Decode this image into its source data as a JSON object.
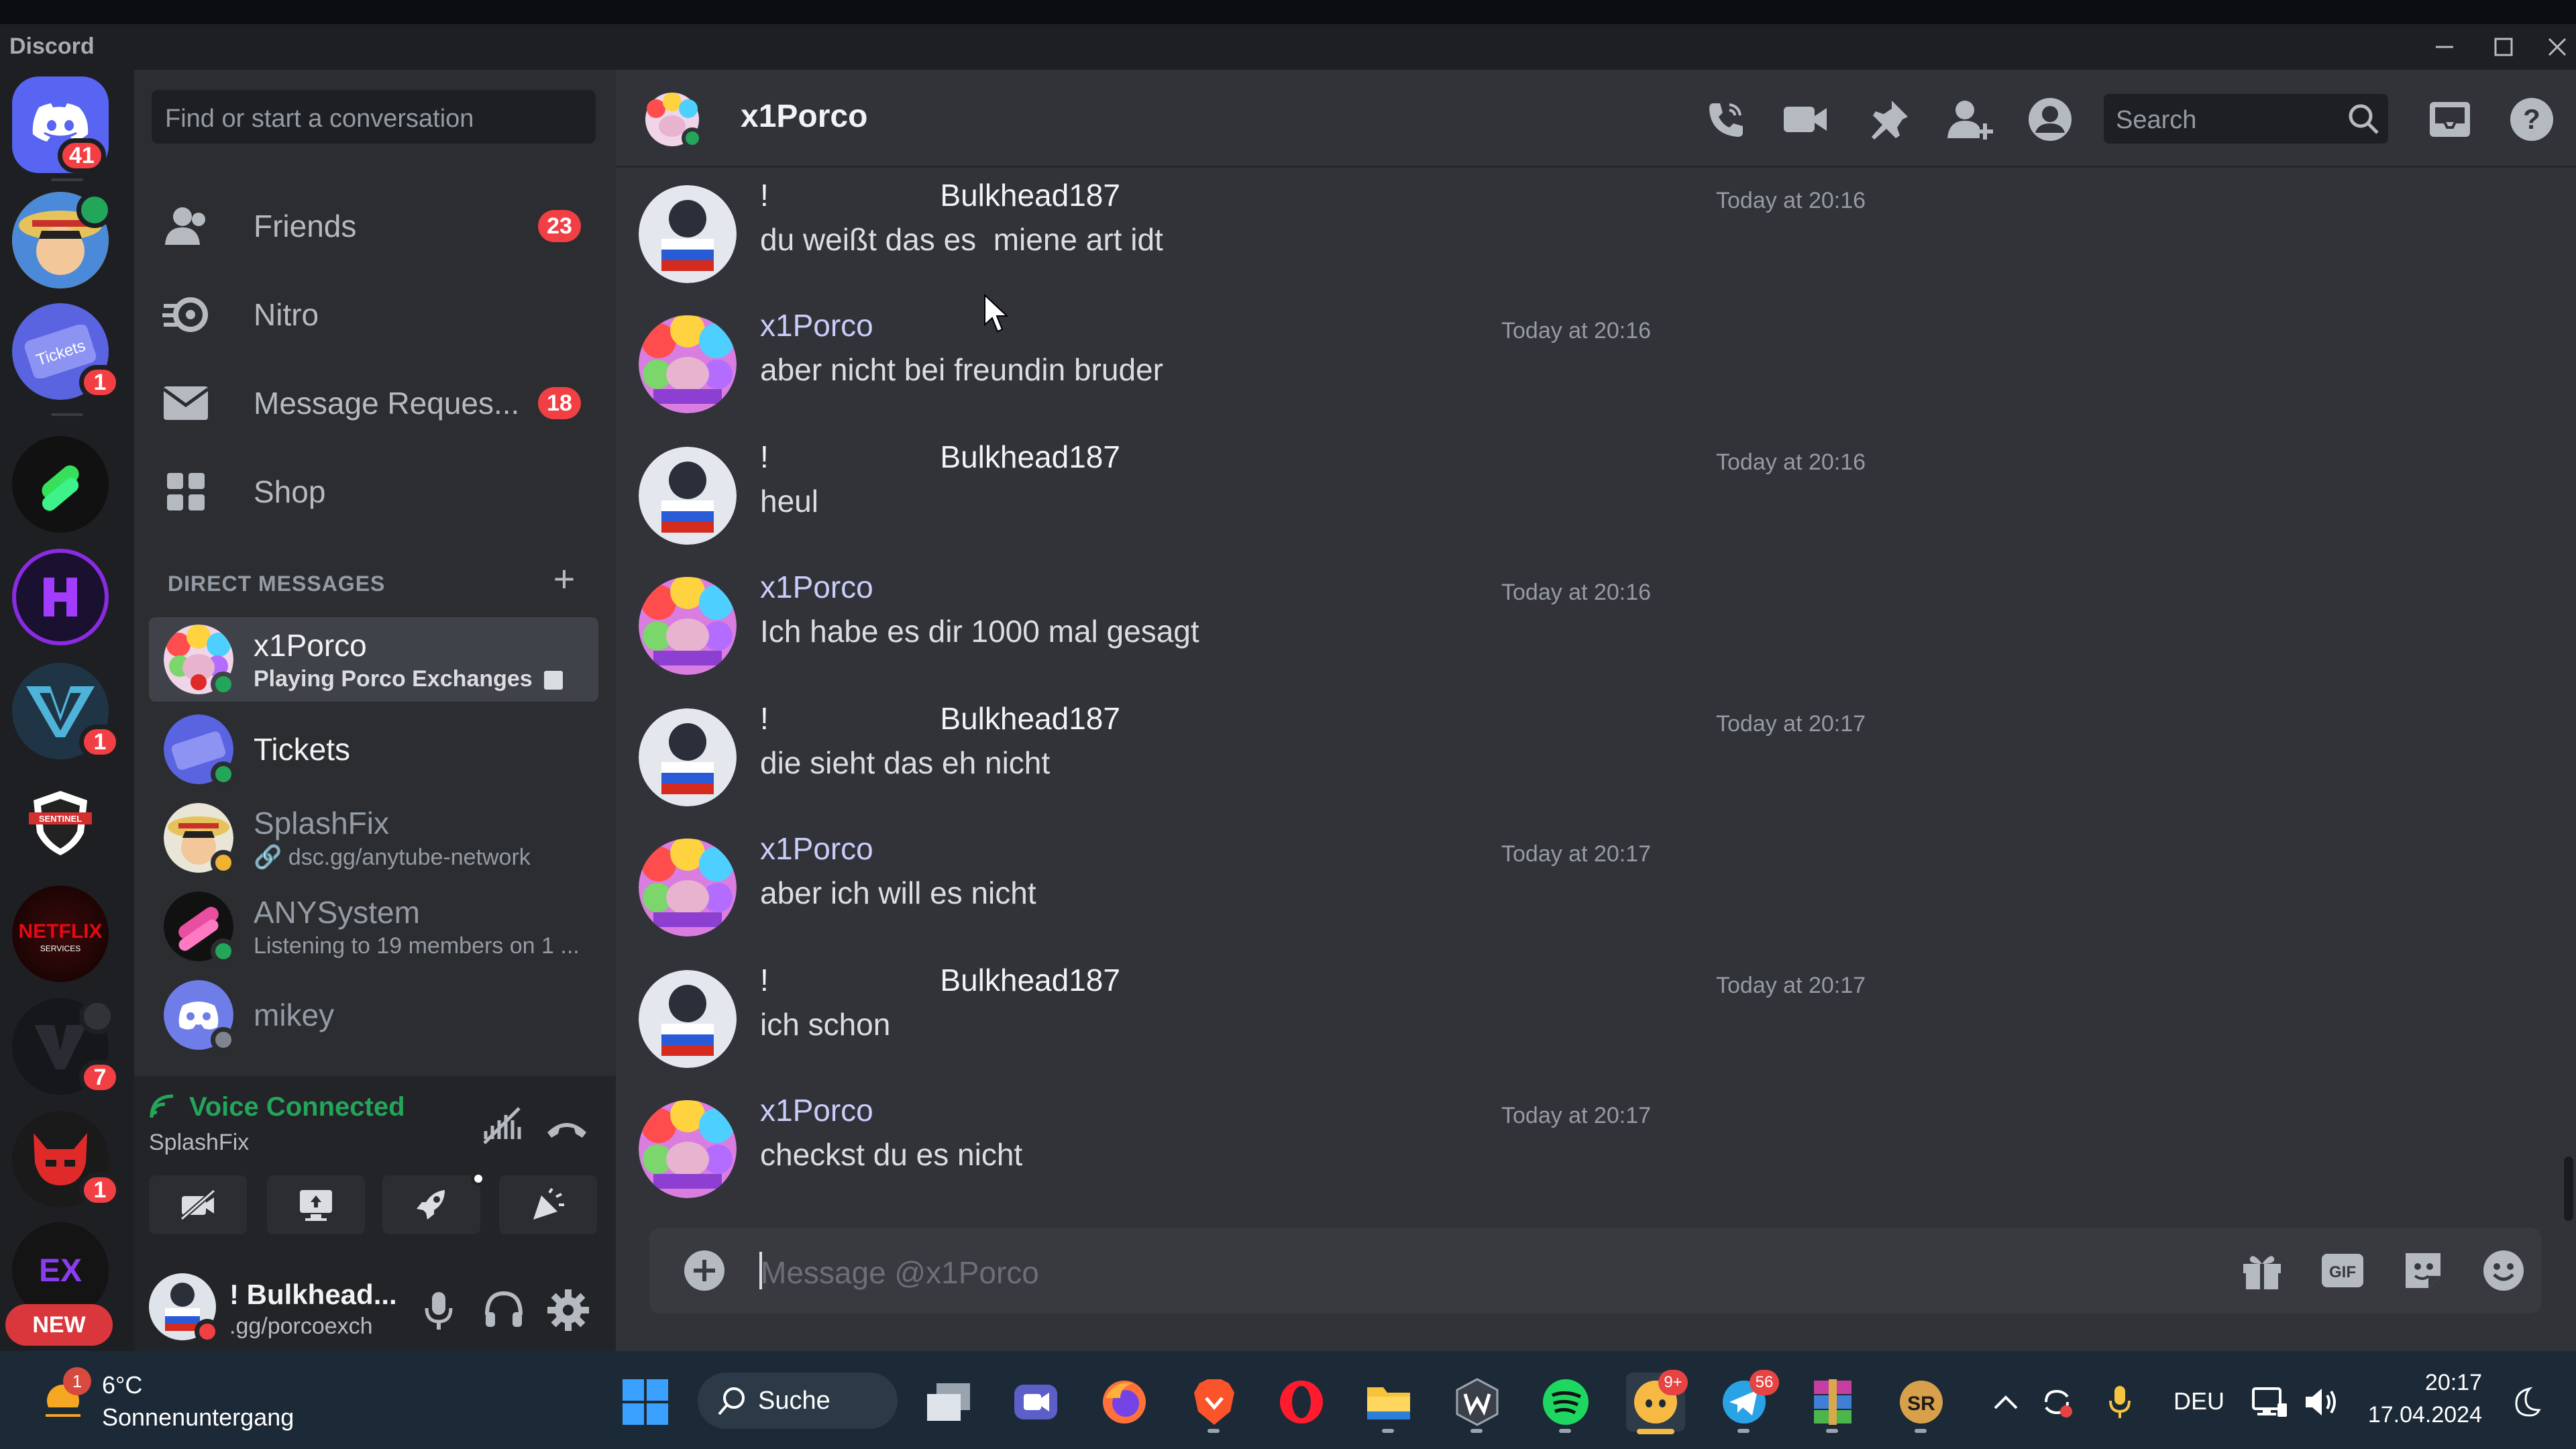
{
  "app": {
    "title": "Discord"
  },
  "servers": [
    {
      "name": "home",
      "badge": "41"
    },
    {
      "name": "SplashFix"
    },
    {
      "name": "Tickets",
      "badge": "1"
    },
    {
      "name": "ANYSystem"
    },
    {
      "name": "H"
    },
    {
      "name": "V",
      "badge": "1"
    },
    {
      "name": "Sentinel",
      "logo_text": "SENTINEL"
    },
    {
      "name": "Netflix Services",
      "logo_text": "NETFLIX",
      "logo_sub": "SERVICES"
    },
    {
      "name": "V dark",
      "badge": "7"
    },
    {
      "name": "Red",
      "badge": "1"
    },
    {
      "name": "EX",
      "logo_text": "EX"
    }
  ],
  "rail_new_label": "NEW",
  "sidebar": {
    "search_placeholder": "Find or start a conversation",
    "nav": [
      {
        "label": "Friends",
        "badge": "23"
      },
      {
        "label": "Nitro"
      },
      {
        "label": "Message Reques...",
        "badge": "18"
      },
      {
        "label": "Shop"
      }
    ],
    "dm_header": "DIRECT MESSAGES",
    "dms": [
      {
        "name": "x1Porco",
        "sub": "Playing Porco Exchanges"
      },
      {
        "name": "Tickets",
        "sub": ""
      },
      {
        "name": "SplashFix",
        "sub": "dsc.gg/anytube-network"
      },
      {
        "name": "ANYSystem",
        "sub": "Listening to 19 members on 1 ..."
      },
      {
        "name": "mikey",
        "sub": ""
      }
    ]
  },
  "voice": {
    "status": "Voice Connected",
    "channel": "SplashFix"
  },
  "user": {
    "name": "! Bulkhead...",
    "sub": ".gg/porcoexch"
  },
  "chat": {
    "recipient": "x1Porco",
    "search_placeholder": "Search",
    "composer_placeholder": "Message @x1Porco",
    "messages": [
      {
        "author": "!                    Bulkhead187",
        "time": "Today at 20:16",
        "text": "du weißt das es  miene art idt"
      },
      {
        "author": "x1Porco",
        "time": "Today at 20:16",
        "text": "aber nicht bei freundin bruder"
      },
      {
        "author": "!                    Bulkhead187",
        "time": "Today at 20:16",
        "text": "heul"
      },
      {
        "author": "x1Porco",
        "time": "Today at 20:16",
        "text": "Ich habe es dir 1000 mal gesagt"
      },
      {
        "author": "!                    Bulkhead187",
        "time": "Today at 20:17",
        "text": "die sieht das eh nicht"
      },
      {
        "author": "x1Porco",
        "time": "Today at 20:17",
        "text": "aber ich will es nicht"
      },
      {
        "author": "!                    Bulkhead187",
        "time": "Today at 20:17",
        "text": "ich schon"
      },
      {
        "author": "x1Porco",
        "time": "Today at 20:17",
        "text": "checkst du es nicht"
      }
    ]
  },
  "taskbar": {
    "weather_temp": "6°C",
    "weather_desc": "Sonnenuntergang",
    "weather_badge": "1",
    "search_label": "Suche",
    "discord_badge": "9+",
    "telegram_badge": "56",
    "lang": "DEU",
    "time": "20:17",
    "date": "17.04.2024"
  },
  "colors": {
    "accent": "#5865f2",
    "online": "#23a55a",
    "badge": "#f23f43",
    "bg_main": "#313338",
    "bg_sidebar": "#2b2d31"
  }
}
